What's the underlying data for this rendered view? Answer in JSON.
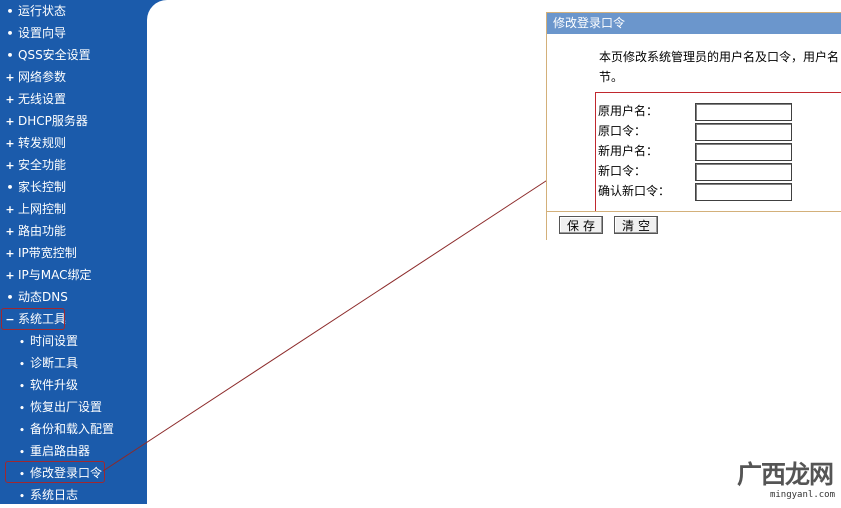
{
  "sidebar": {
    "items": [
      {
        "label": "运行状态",
        "bullet": "•",
        "kind": "top"
      },
      {
        "label": "设置向导",
        "bullet": "•",
        "kind": "top"
      },
      {
        "label": "QSS安全设置",
        "bullet": "•",
        "kind": "top"
      },
      {
        "label": "网络参数",
        "bullet": "+",
        "kind": "top"
      },
      {
        "label": "无线设置",
        "bullet": "+",
        "kind": "top"
      },
      {
        "label": "DHCP服务器",
        "bullet": "+",
        "kind": "top"
      },
      {
        "label": "转发规则",
        "bullet": "+",
        "kind": "top"
      },
      {
        "label": "安全功能",
        "bullet": "+",
        "kind": "top"
      },
      {
        "label": "家长控制",
        "bullet": "•",
        "kind": "top"
      },
      {
        "label": "上网控制",
        "bullet": "+",
        "kind": "top"
      },
      {
        "label": "路由功能",
        "bullet": "+",
        "kind": "top"
      },
      {
        "label": "IP带宽控制",
        "bullet": "+",
        "kind": "top"
      },
      {
        "label": "IP与MAC绑定",
        "bullet": "+",
        "kind": "top"
      },
      {
        "label": "动态DNS",
        "bullet": "•",
        "kind": "top"
      },
      {
        "label": "系统工具",
        "bullet": "−",
        "kind": "top"
      },
      {
        "label": "时间设置",
        "bullet": "•",
        "kind": "sub"
      },
      {
        "label": "诊断工具",
        "bullet": "•",
        "kind": "sub"
      },
      {
        "label": "软件升级",
        "bullet": "•",
        "kind": "sub"
      },
      {
        "label": "恢复出厂设置",
        "bullet": "•",
        "kind": "sub"
      },
      {
        "label": "备份和载入配置",
        "bullet": "•",
        "kind": "sub"
      },
      {
        "label": "重启路由器",
        "bullet": "•",
        "kind": "sub"
      },
      {
        "label": "修改登录口令",
        "bullet": "•",
        "kind": "sub"
      },
      {
        "label": "系统日志",
        "bullet": "•",
        "kind": "sub"
      }
    ],
    "background": "#1b5bab"
  },
  "panel": {
    "title": "修改登录口令",
    "description_line1": "本页修改系统管理员的用户名及口令，用户名",
    "description_line2": "节。",
    "fields": [
      {
        "label": "原用户名：",
        "value": ""
      },
      {
        "label": "原口令：",
        "value": ""
      },
      {
        "label": "新用户名：",
        "value": ""
      },
      {
        "label": "新口令：",
        "value": ""
      },
      {
        "label": "确认新口令：",
        "value": ""
      }
    ],
    "save_label": "保存",
    "clear_label": "清空",
    "header_color": "#6b96cc",
    "highlight_color": "#c0282e"
  },
  "watermark": {
    "logo_text": "广西龙网",
    "url_text": "mingyanl.com"
  }
}
